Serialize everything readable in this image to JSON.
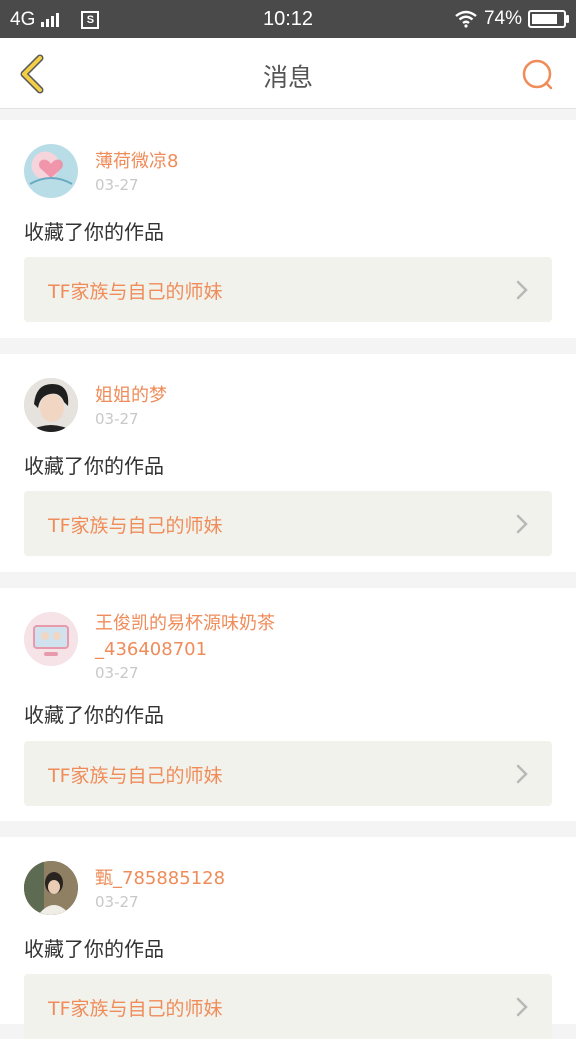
{
  "status_bar": {
    "network": "4G",
    "sim_icon": "S",
    "time": "10:12",
    "battery": "74%"
  },
  "header": {
    "title": "消息",
    "back_icon": "chevron-left-icon",
    "search_icon": "search-icon"
  },
  "colors": {
    "accent": "#ef8c5a",
    "back_icon": "#f2cf44",
    "date": "#c8c8c8",
    "link_bg": "#f2f2ec"
  },
  "messages": [
    {
      "username": "薄荷微凉8",
      "date": "03-27",
      "action": "收藏了你的作品",
      "work_title": "TF家族与自己的师妹"
    },
    {
      "username": "姐姐的梦",
      "date": "03-27",
      "action": "收藏了你的作品",
      "work_title": "TF家族与自己的师妹"
    },
    {
      "username": "王俊凯的易杯源味奶茶",
      "username_line2": "_436408701",
      "date": "03-27",
      "action": "收藏了你的作品",
      "work_title": "TF家族与自己的师妹"
    },
    {
      "username": "甄_785885128",
      "date": "03-27",
      "action": "收藏了你的作品",
      "work_title": "TF家族与自己的师妹"
    }
  ]
}
